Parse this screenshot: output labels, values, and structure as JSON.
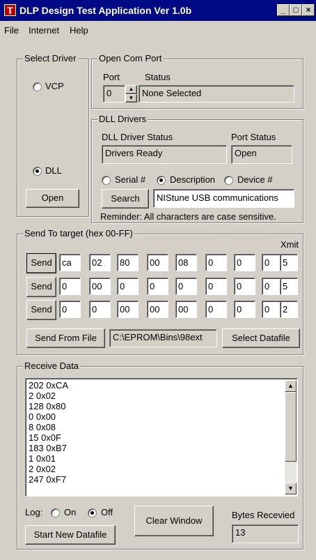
{
  "window": {
    "icon_letter": "T",
    "title": "DLP Design Test Application   Ver 1.0b",
    "minimize": "_",
    "maximize": "□",
    "close": "×"
  },
  "menu": {
    "file": "File",
    "internet": "Internet",
    "help": "Help"
  },
  "select_driver": {
    "legend": "Select Driver",
    "vcp_label": "VCP",
    "dll_label": "DLL",
    "selected": "DLL",
    "open_button": "Open"
  },
  "com_port": {
    "legend": "Open Com Port",
    "port_label": "Port",
    "status_label": "Status",
    "port_value": "0",
    "status_value": "None Selected"
  },
  "dll_drivers": {
    "legend": "DLL Drivers",
    "driver_status_label": "DLL Driver Status",
    "port_status_label": "Port Status",
    "driver_status_value": "Drivers Ready",
    "port_status_value": "Open",
    "serial_label": "Serial #",
    "description_label": "Description",
    "device_label": "Device #",
    "selected_option": "Description",
    "search_button": "Search",
    "search_value": "NIStune USB communications",
    "reminder": "Reminder: All characters are case sensitive."
  },
  "send": {
    "legend": "Send To target (hex 00-FF)",
    "xmit_label": "Xmit",
    "send_button": "Send",
    "rows": [
      {
        "values": [
          "ca",
          "02",
          "80",
          "00",
          "08",
          "0",
          "0",
          "0"
        ],
        "xmit": "5"
      },
      {
        "values": [
          "0",
          "00",
          "0",
          "0",
          "0",
          "0",
          "0",
          "0"
        ],
        "xmit": "5"
      },
      {
        "values": [
          "0",
          "0",
          "00",
          "00",
          "00",
          "0",
          "0",
          "0"
        ],
        "xmit": "2"
      }
    ],
    "send_from_file_button": "Send From File",
    "file_path": "C:\\EPROM\\Bins\\98ext",
    "select_datafile_button": "Select Datafile"
  },
  "receive": {
    "legend": "Receive Data",
    "lines": [
      "202  0xCA",
      "2  0x02",
      "128  0x80",
      "0  0x00",
      "8  0x08",
      "15  0x0F",
      "183  0xB7",
      "1  0x01",
      "2  0x02",
      "247  0xF7"
    ],
    "log_label": "Log:",
    "on_label": "On",
    "off_label": "Off",
    "log_selected": "Off",
    "start_datafile_button": "Start New Datafile",
    "clear_button": "Clear Window",
    "bytes_label": "Bytes Recevied",
    "bytes_value": "13"
  }
}
